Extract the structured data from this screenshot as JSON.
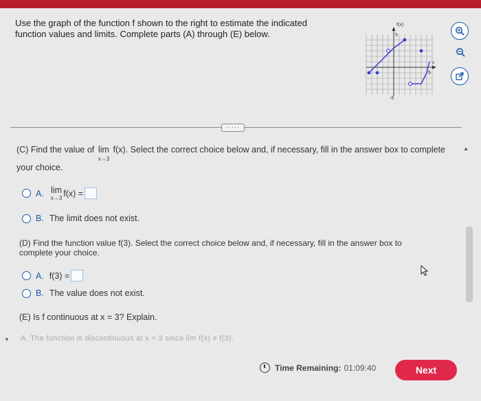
{
  "instructions": "Use the graph of the function f shown to the right to estimate the indicated function values and limits. Complete parts (A) through (E) below.",
  "graph": {
    "label_fx": "f(x)",
    "label_x": "x",
    "tick_top": "5",
    "tick_right": "5",
    "tick_bottom": "-5"
  },
  "tools": {
    "zoom_in": "zoom-in",
    "zoom_out": "zoom-out",
    "popout": "popout"
  },
  "divider_button": "·····",
  "partC": {
    "prompt_before": "(C) Find the value of",
    "lim": "lim",
    "lim_sub": "x→3",
    "prompt_after": "f(x). Select the correct choice below and, if necessary, fill in the answer box to complete your choice.",
    "choiceA_letter": "A.",
    "choiceA_lim": "lim",
    "choiceA_sub": "x→3",
    "choiceA_text": "f(x) =",
    "choiceB_letter": "B.",
    "choiceB_text": "The limit does not exist."
  },
  "partD": {
    "prompt": "(D) Find the function value f(3). Select the correct choice below and, if necessary, fill in the answer box to complete your choice.",
    "choiceA_letter": "A.",
    "choiceA_text": "f(3) =",
    "choiceB_letter": "B.",
    "choiceB_text": "The value does not exist."
  },
  "partE": {
    "prompt": "(E) Is f continuous at x = 3? Explain.",
    "cutoff_text": "A.  The function is discontinuous at x = 3 since lim f(x) ≠ f(3)."
  },
  "footer": {
    "time_label": "Time Remaining:",
    "time_value": "01:09:40",
    "next_label": "Next"
  }
}
